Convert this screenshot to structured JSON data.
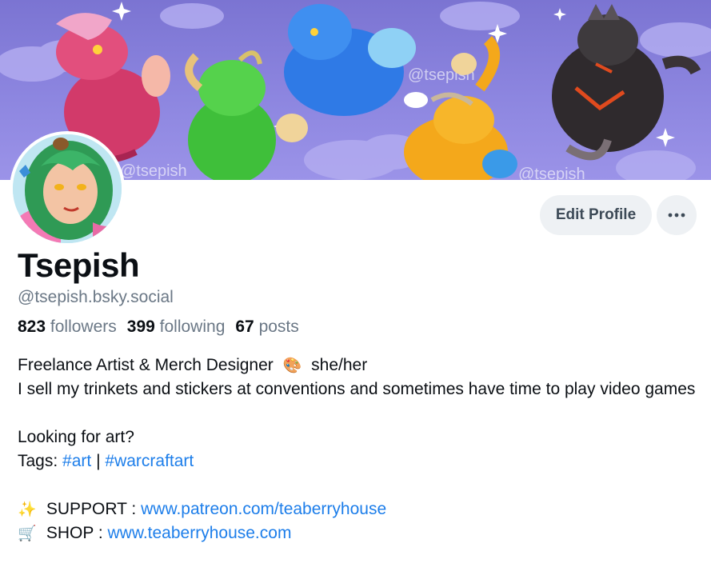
{
  "profile": {
    "display_name": "Tsepish",
    "handle": "@tsepish.bsky.social",
    "banner_watermarks": [
      "@tsepish",
      "@tsepish",
      "@tsepish"
    ]
  },
  "actions": {
    "edit_profile_label": "Edit Profile",
    "more_icon": "ellipsis-icon"
  },
  "stats": {
    "followers_count": "823",
    "followers_label": "followers",
    "following_count": "399",
    "following_label": "following",
    "posts_count": "67",
    "posts_label": "posts"
  },
  "bio": {
    "line1": "Freelance Artist & Merch Designer",
    "line1_emoji": "🎨",
    "line1_tail": "she/her",
    "line2": "I sell my trinkets and stickers at conventions and sometimes have time to play video games",
    "line3": "Looking for art?",
    "tags_label": "Tags:",
    "tag1": "#art",
    "tag_separator": "|",
    "tag2": "#warcraftart",
    "support_emoji": "✨",
    "support_label": "SUPPORT :",
    "support_link": "www.patreon.com/teaberryhouse",
    "shop_emoji": "🛒",
    "shop_label": "SHOP :",
    "shop_link": "www.teaberryhouse.com"
  },
  "colors": {
    "banner_purple": "#8d86e0",
    "link_blue": "#1d7eea",
    "muted_text": "#6b7886",
    "button_bg": "#eef1f4"
  }
}
